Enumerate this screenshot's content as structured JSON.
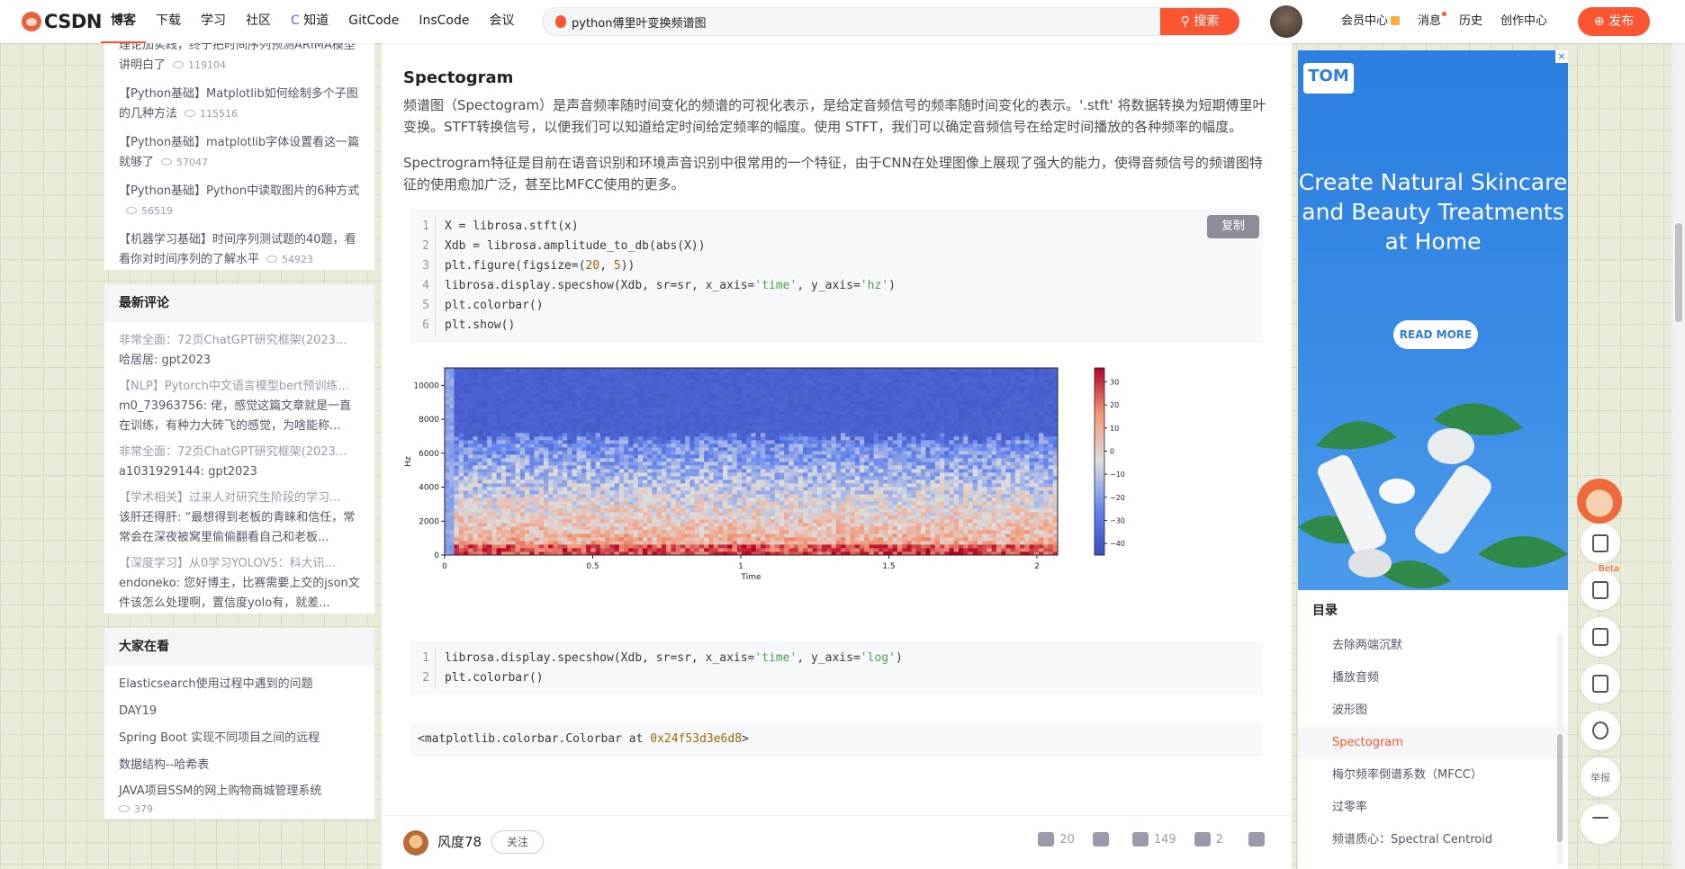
{
  "topbar": {
    "logo_text": "CSDN",
    "nav": [
      "博客",
      "下载",
      "学习",
      "社区",
      "知道",
      "GitCode",
      "InsCode",
      "会议"
    ],
    "search_value": "python傅里叶变换频谱图",
    "search_button": "搜索",
    "right_nav": [
      "会员中心",
      "消息",
      "历史",
      "创作中心"
    ],
    "publish": "发布"
  },
  "sidebar": {
    "hot_articles": [
      {
        "title": "理论加实践，终于把时间序列预测ARIMA模型讲明白了",
        "views": "119104"
      },
      {
        "title": "【Python基础】Matplotlib如何绘制多个子图的几种方法",
        "views": "115516"
      },
      {
        "title": "【Python基础】matplotlib字体设置看这一篇就够了",
        "views": "57047"
      },
      {
        "title": "【Python基础】Python中读取图片的6种方式",
        "views": "56519"
      },
      {
        "title": "【机器学习基础】时间序列测试题的40题，看看你对时间序列的了解水平",
        "views": "54923"
      }
    ],
    "comments_title": "最新评论",
    "comments": [
      {
        "title": "非常全面：72页ChatGPT研究框架(2023...",
        "body": "哈居居: gpt2023"
      },
      {
        "title": "【NLP】Pytorch中文语言模型bert预训练...",
        "body": "m0_73963756: 佬，感觉这篇文章就是一直在训练，有种力大砖飞的感觉，为啥能称..."
      },
      {
        "title": "非常全面：72页ChatGPT研究框架(2023...",
        "body": "a1031929144: gpt2023"
      },
      {
        "title": "【学术相关】过来人对研究生阶段的学习...",
        "body": "该肝还得肝: “最想得到老板的青睐和信任，常常会在深夜被窝里偷偷翻看自己和老板..."
      },
      {
        "title": "【深度学习】从0学习YOLOV5：科大讯...",
        "body": "endoneko: 您好博主，比赛需要上交的json文件该怎么处理啊，置信度yolo有，就差..."
      }
    ],
    "hot_now_title": "大家在看",
    "hot_now": [
      "Elasticsearch使用过程中遇到的问题",
      "DAY19",
      "Spring Boot 实现不同项目之间的远程",
      "数据结构--哈希表",
      "JAVA项目SSM的网上购物商城管理系统"
    ],
    "hot_now_views": "379"
  },
  "article": {
    "heading": "Spectogram",
    "para1": "频谱图（Spectogram）是声音频率随时间变化的频谱的可视化表示，是给定音频信号的频率随时间变化的表示。'.stft' 将数据转换为短期傅里叶变换。STFT转换信号，以便我们可以知道给定时间给定频率的幅度。使用 STFT，我们可以确定音频信号在给定时间播放的各种频率的幅度。",
    "para2": "Spectrogram特征是目前在语音识别和环境声音识别中很常用的一个特征，由于CNN在处理图像上展现了强大的能力，使得音频信号的频谱图特征的使用愈加广泛，甚至比MFCC使用的更多。",
    "copy_label": "复制",
    "code1_lines": [
      "1",
      "2",
      "3",
      "4",
      "5",
      "6"
    ],
    "code2_lines": [
      "1",
      "2"
    ],
    "output_text": "<matplotlib.colorbar.Colorbar at ",
    "output_addr": "0x24f53d3e6d8",
    "output_end": ">"
  },
  "chart_data": {
    "type": "heatmap",
    "xlabel": "Time",
    "ylabel": "Hz",
    "x_ticks": [
      "0",
      "0.5",
      "1",
      "1.5",
      "2"
    ],
    "y_ticks": [
      "0",
      "2000",
      "4000",
      "6000",
      "8000",
      "10000"
    ],
    "colorbar_ticks": [
      "30",
      "20",
      "10",
      "0",
      "−10",
      "−20",
      "−30",
      "−40"
    ],
    "xlim": [
      0,
      2.07
    ],
    "ylim": [
      0,
      11025
    ],
    "colorbar_range": [
      -45,
      36
    ],
    "colormap": "coolwarm"
  },
  "bottombar": {
    "author": "风度78",
    "follow": "关注",
    "likes": "20",
    "stars": "149",
    "comments": "2"
  },
  "ad": {
    "close": "×",
    "logo": "TOM",
    "title": "Create Natural Skincare and Beauty Treatments at Home",
    "button": "READ MORE"
  },
  "toc": {
    "title": "目录",
    "items": [
      "去除两端沉默",
      "播放音频",
      "波形图",
      "Spectogram",
      "梅尔频率倒谱系数（MFCC）",
      "过零率",
      "频谱质心：Spectral Centroid"
    ],
    "active_index": 3
  },
  "floatbar": {
    "beta": "Beta",
    "report": "举报"
  },
  "colors": {
    "accent": "#fc5531",
    "ad_blue": "#2c7ee0",
    "code_bg": "#f6f8fa"
  }
}
